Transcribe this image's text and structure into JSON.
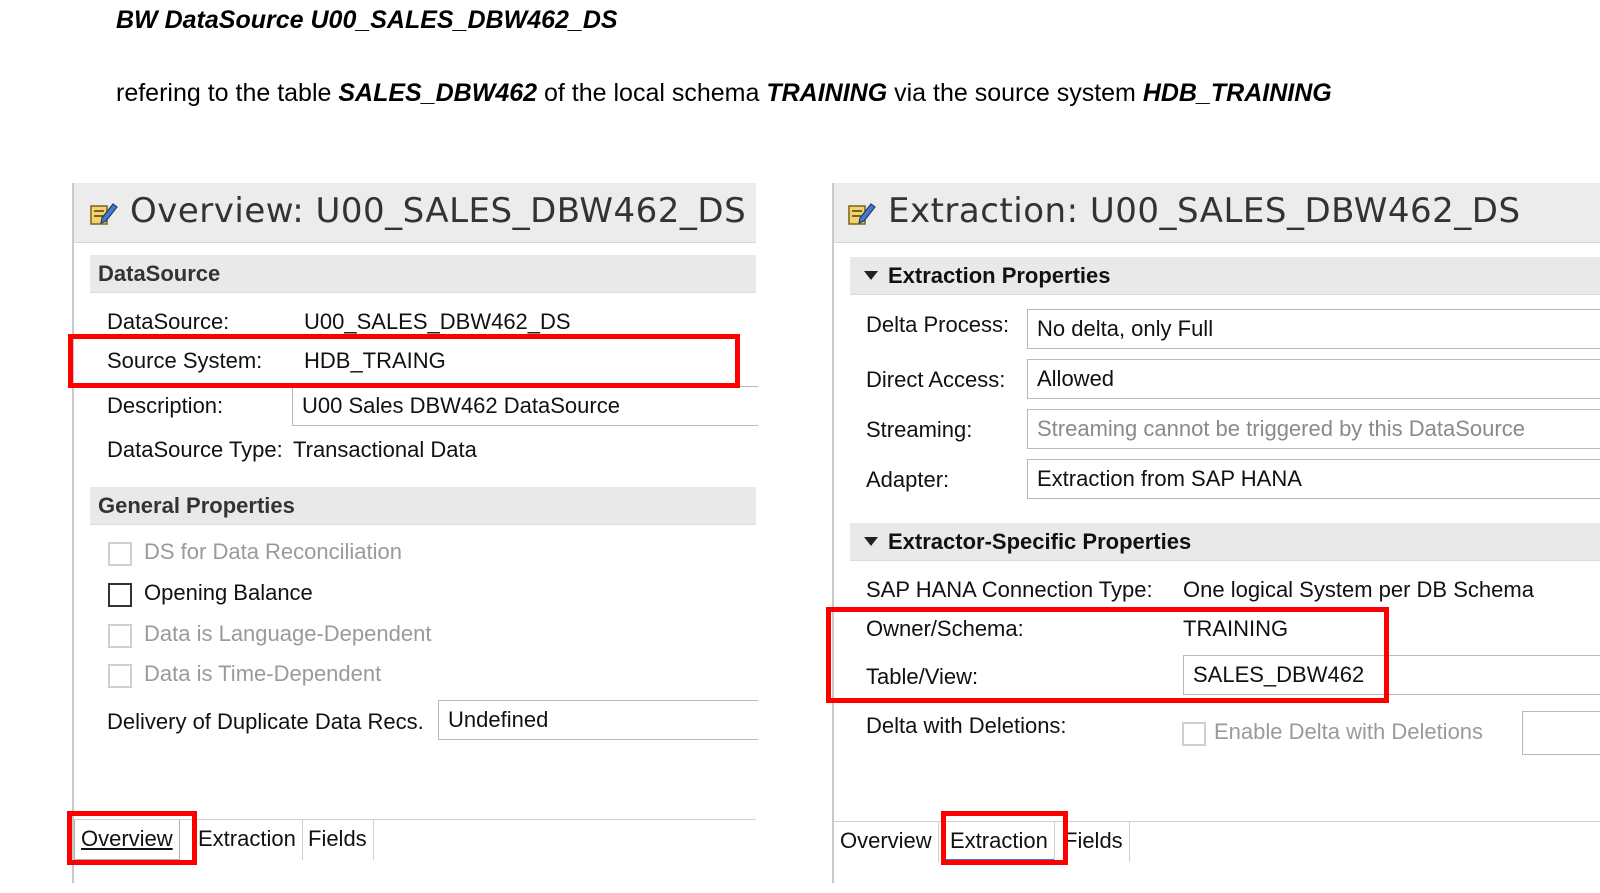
{
  "doc": {
    "heading": "BW DataSource U00_SALES_DBW462_DS",
    "subline_parts": [
      "refering to the table ",
      "SALES_DBW462",
      " of the local schema ",
      "TRAINING",
      " via the source system ",
      "HDB_TRAINING"
    ]
  },
  "overview": {
    "title": "Overview: U00_SALES_DBW462_DS",
    "section_datasource": "DataSource",
    "rows": {
      "datasource_label": "DataSource:",
      "datasource_value": "U00_SALES_DBW462_DS",
      "source_system_label": "Source System:",
      "source_system_value": "HDB_TRAING",
      "description_label": "Description:",
      "description_value": "U00 Sales DBW462 DataSource",
      "type_label": "DataSource Type:",
      "type_value": "Transactional Data"
    },
    "section_general": "General Properties",
    "checkboxes": [
      {
        "label": "DS for Data Reconciliation",
        "checked": false,
        "enabled": false
      },
      {
        "label": "Opening Balance",
        "checked": false,
        "enabled": true
      },
      {
        "label": "Data is Language-Dependent",
        "checked": false,
        "enabled": false
      },
      {
        "label": "Data is Time-Dependent",
        "checked": false,
        "enabled": false
      }
    ],
    "duplicate_label": "Delivery of Duplicate Data Recs.",
    "duplicate_value": "Undefined",
    "tabs": [
      "Overview",
      "Extraction",
      "Fields"
    ],
    "active_tab": "Overview"
  },
  "extraction": {
    "title": "Extraction: U00_SALES_DBW462_DS",
    "section_props": "Extraction Properties",
    "delta_process_label": "Delta Process:",
    "delta_process_value": "No delta, only Full",
    "direct_access_label": "Direct Access:",
    "direct_access_value": "Allowed",
    "streaming_label": "Streaming:",
    "streaming_value": "Streaming cannot be triggered by this DataSource",
    "adapter_label": "Adapter:",
    "adapter_value": "Extraction from SAP HANA",
    "section_extractor": "Extractor-Specific Properties",
    "conn_type_label": "SAP HANA Connection Type:",
    "conn_type_value": "One logical System per DB Schema",
    "owner_label": "Owner/Schema:",
    "owner_value": "TRAINING",
    "table_label": "Table/View:",
    "table_value": "SALES_DBW462",
    "delta_del_label": "Delta with Deletions:",
    "delta_del_checkbox": "Enable Delta with Deletions",
    "tabs": [
      "Overview",
      "Extraction",
      "Fields"
    ],
    "active_tab": "Extraction"
  },
  "colors": {
    "highlight": "#ff0000",
    "active_tab_underline": "#3a7bd5"
  }
}
